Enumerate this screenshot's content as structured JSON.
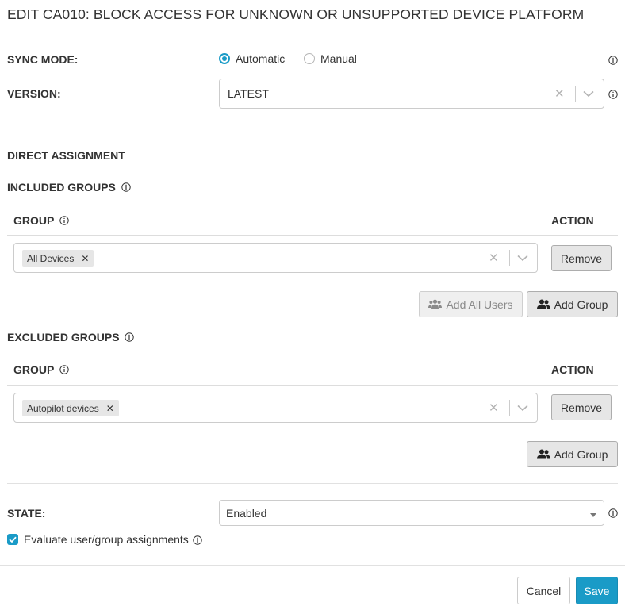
{
  "dialog": {
    "title": "EDIT CA010: BLOCK ACCESS FOR UNKNOWN OR UNSUPPORTED DEVICE PLATFORM"
  },
  "sync_mode": {
    "label": "SYNC MODE:",
    "options": [
      "Automatic",
      "Manual"
    ],
    "selected": "Automatic"
  },
  "version": {
    "label": "VERSION:",
    "value": "LATEST"
  },
  "direct_assignment": {
    "heading": "DIRECT ASSIGNMENT"
  },
  "included": {
    "heading": "INCLUDED GROUPS",
    "col_group": "GROUP",
    "col_action": "ACTION",
    "tags": [
      "All Devices"
    ],
    "remove_label": "Remove",
    "add_all_users_label": "Add All Users",
    "add_group_label": "Add Group"
  },
  "excluded": {
    "heading": "EXCLUDED GROUPS",
    "col_group": "GROUP",
    "col_action": "ACTION",
    "tags": [
      "Autopilot devices"
    ],
    "remove_label": "Remove",
    "add_group_label": "Add Group"
  },
  "state": {
    "label": "STATE:",
    "value": "Enabled"
  },
  "evaluate": {
    "label": "Evaluate user/group assignments",
    "checked": true
  },
  "footer": {
    "cancel_label": "Cancel",
    "save_label": "Save"
  },
  "colors": {
    "accent": "#1a9bc7",
    "button_gray": "#e6e6e6",
    "border": "#cccccc"
  }
}
